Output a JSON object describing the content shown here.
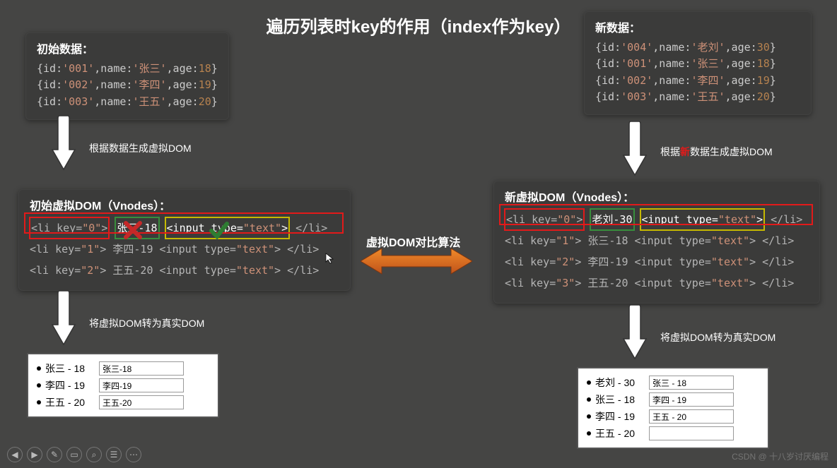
{
  "title": "遍历列表时key的作用（index作为key）",
  "initialData": {
    "title": "初始数据：",
    "rows": [
      "{id:'001',name:'张三',age:18}",
      "{id:'002',name:'李四',age:19}",
      "{id:'003',name:'王五',age:20}"
    ]
  },
  "newData": {
    "title": "新数据：",
    "rows": [
      "{id:'004',name:'老刘',age:30}",
      "{id:'001',name:'张三',age:18}",
      "{id:'002',name:'李四',age:19}",
      "{id:'003',name:'王五',age:20}"
    ]
  },
  "genLabelLeft": "根据数据生成虚拟DOM",
  "genLabelRightA": "根据",
  "genLabelRightHL": "新",
  "genLabelRightB": "数据生成虚拟DOM",
  "initialVDOM": {
    "title": "初始虚拟DOM（Vnodes）：",
    "lines": [
      {
        "key": "0",
        "text": "张三-18",
        "input": "<input type=\"text\">"
      },
      {
        "key": "1",
        "text": "李四-19",
        "input": "<input type=\"text\">"
      },
      {
        "key": "2",
        "text": "王五-20",
        "input": "<input type=\"text\">"
      }
    ]
  },
  "newVDOM": {
    "title": "新虚拟DOM（Vnodes）：",
    "lines": [
      {
        "key": "0",
        "text": "老刘-30",
        "input": "<input type=\"text\">"
      },
      {
        "key": "1",
        "text": "张三-18",
        "input": "<input type=\"text\">"
      },
      {
        "key": "2",
        "text": "李四-19",
        "input": "<input type=\"text\">"
      },
      {
        "key": "3",
        "text": "王五-20",
        "input": "<input type=\"text\">"
      }
    ]
  },
  "diffLabel": "虚拟DOM对比算法",
  "toRealLabel": "将虚拟DOM转为真实DOM",
  "realDomLeft": [
    {
      "label": "张三 - 18",
      "value": "张三-18"
    },
    {
      "label": "李四 - 19",
      "value": "李四-19"
    },
    {
      "label": "王五 - 20",
      "value": "王五-20"
    }
  ],
  "realDomRight": [
    {
      "label": "老刘 - 30",
      "value": "张三 - 18"
    },
    {
      "label": "张三 - 18",
      "value": "李四 - 19"
    },
    {
      "label": "李四 - 19",
      "value": "王五 - 20"
    },
    {
      "label": "王五 - 20",
      "value": ""
    }
  ],
  "watermark": "CSDN @ 十八岁讨厌编程",
  "tb": {
    "prev": "◀",
    "next": "▶",
    "pen": "✎",
    "book": "▭",
    "zoom": "⌕",
    "list": "☰",
    "more": "⋯"
  }
}
